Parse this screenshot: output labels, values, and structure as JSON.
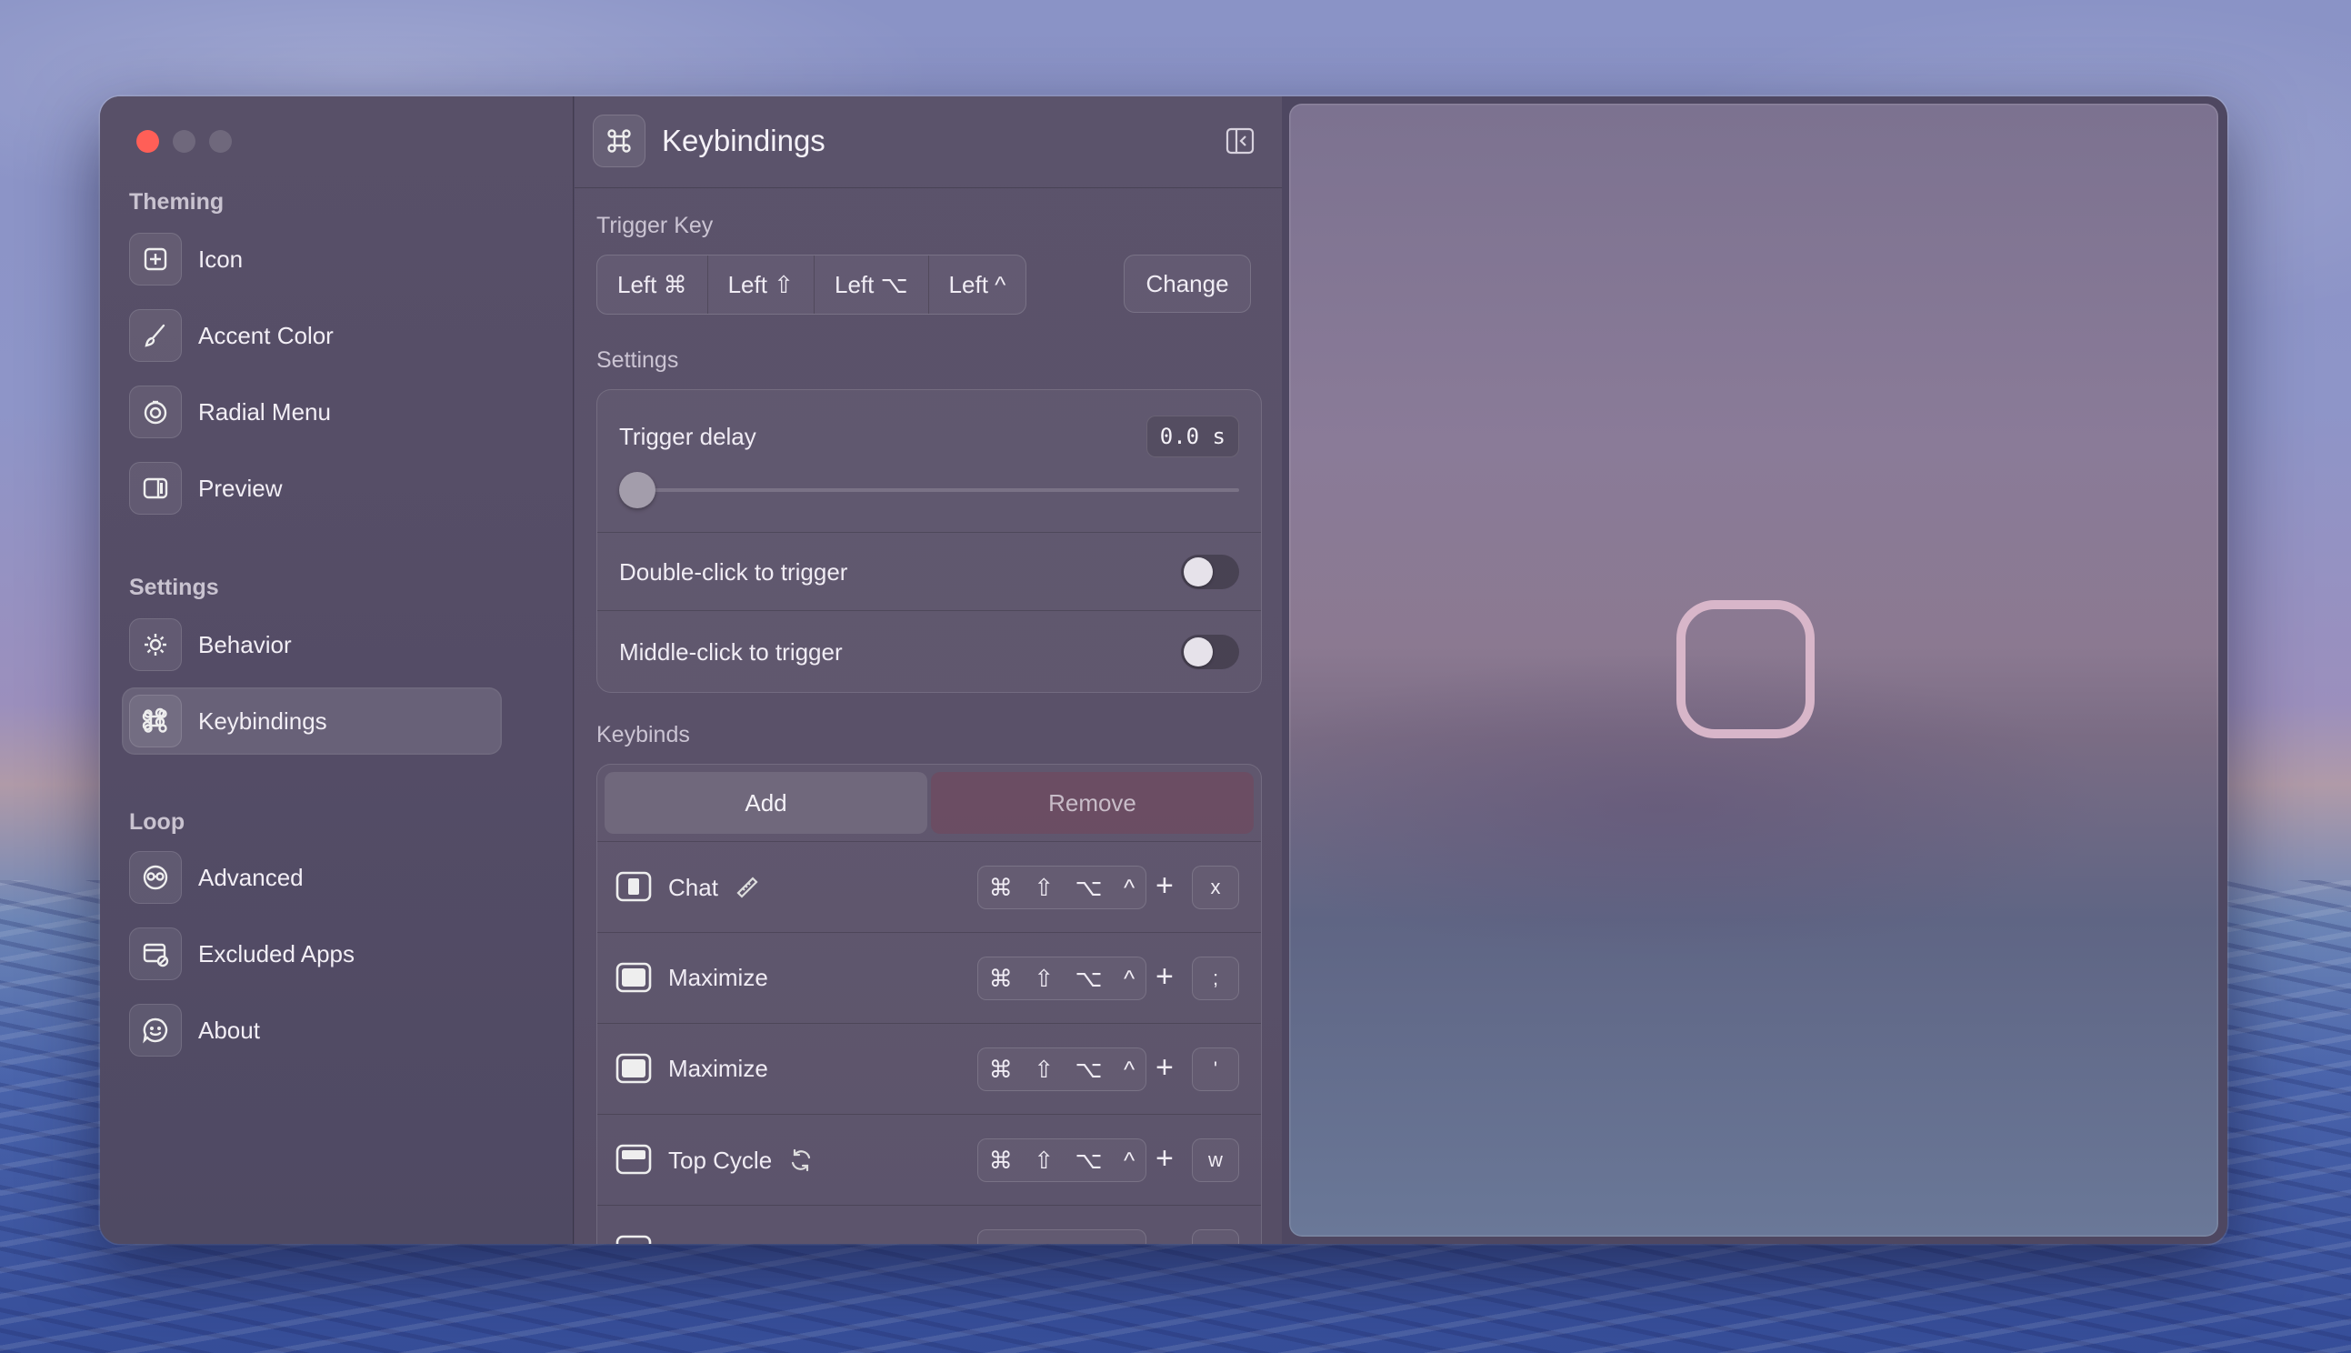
{
  "sidebar": {
    "sections": [
      {
        "title": "Theming",
        "items": [
          {
            "label": "Icon",
            "icon": "app-icon"
          },
          {
            "label": "Accent Color",
            "icon": "paintbrush-icon"
          },
          {
            "label": "Radial Menu",
            "icon": "radial-menu-icon"
          },
          {
            "label": "Preview",
            "icon": "preview-icon"
          }
        ]
      },
      {
        "title": "Settings",
        "items": [
          {
            "label": "Behavior",
            "icon": "gear-icon"
          },
          {
            "label": "Keybindings",
            "icon": "command-icon",
            "selected": true
          }
        ]
      },
      {
        "title": "Loop",
        "items": [
          {
            "label": "Advanced",
            "icon": "advanced-icon"
          },
          {
            "label": "Excluded Apps",
            "icon": "excluded-apps-icon"
          },
          {
            "label": "About",
            "icon": "about-icon"
          }
        ]
      }
    ]
  },
  "header": {
    "title": "Keybindings",
    "icon": "command-icon"
  },
  "trigger_key": {
    "label": "Trigger Key",
    "keys": [
      "Left ⌘",
      "Left ⇧",
      "Left ⌥",
      "Left ^"
    ],
    "change_label": "Change"
  },
  "settings": {
    "label": "Settings",
    "trigger_delay": {
      "label": "Trigger delay",
      "value": "0.0 s",
      "slider_fraction": 0.0
    },
    "double_click": {
      "label": "Double-click to trigger",
      "on": false
    },
    "middle_click": {
      "label": "Middle-click to trigger",
      "on": false
    }
  },
  "keybinds": {
    "label": "Keybinds",
    "add_label": "Add",
    "remove_label": "Remove",
    "modifiers": [
      "⌘",
      "⇧",
      "⌥",
      "^"
    ],
    "plus": "+",
    "rows": [
      {
        "label": "Chat",
        "key": "x",
        "extra_icon": "ruler-icon"
      },
      {
        "label": "Maximize",
        "key": ";",
        "extra_icon": ""
      },
      {
        "label": "Maximize",
        "key": "'",
        "extra_icon": ""
      },
      {
        "label": "Top Cycle",
        "key": "w",
        "extra_icon": "cycle-icon"
      }
    ]
  },
  "colors": {
    "accent_preview": "#d8b6c9",
    "close_button": "#ff5f57"
  }
}
